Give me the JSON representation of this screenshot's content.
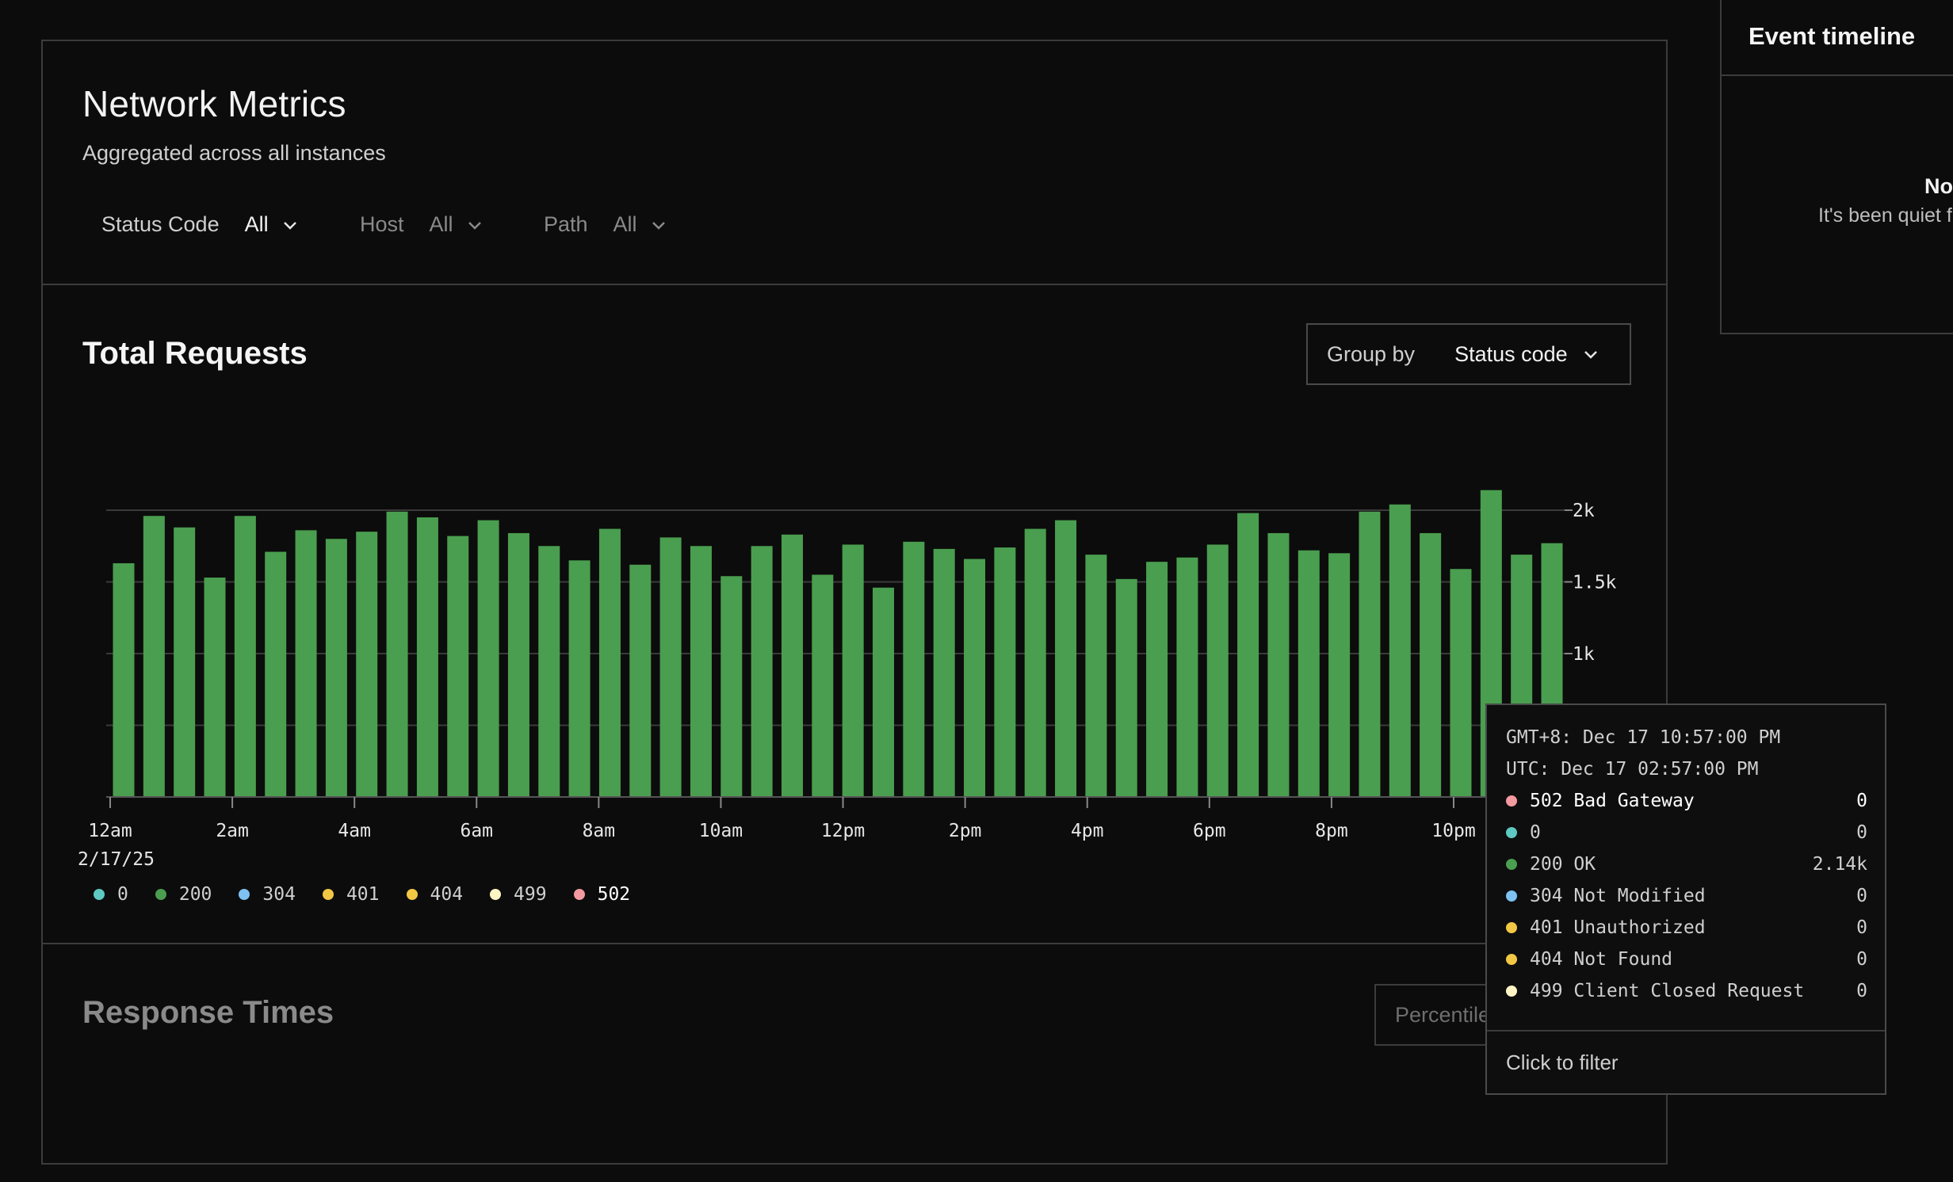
{
  "header": {
    "title": "Network Metrics",
    "subtitle": "Aggregated across all instances",
    "filters": [
      {
        "label": "Status Code",
        "value": "All"
      },
      {
        "label": "Host",
        "value": "All"
      },
      {
        "label": "Path",
        "value": "All"
      }
    ]
  },
  "requests": {
    "title": "Total Requests",
    "group_by_label": "Group by",
    "group_by_value": "Status code"
  },
  "chart_data": {
    "type": "bar",
    "title": "Total Requests",
    "x_tick_labels": [
      "12am",
      "2am",
      "4am",
      "6am",
      "8am",
      "10am",
      "12pm",
      "2pm",
      "4pm",
      "6pm",
      "8pm",
      "10pm"
    ],
    "date_label": "2/17/25",
    "y_tick_labels": [
      "2k",
      "1.5k",
      "1k"
    ],
    "ylim": [
      0,
      2000
    ],
    "grid": true,
    "series": [
      {
        "name": "200",
        "color": "#4a9e4f",
        "values": [
          1630,
          1960,
          1880,
          1530,
          1960,
          1710,
          1860,
          1800,
          1850,
          1990,
          1950,
          1820,
          1930,
          1840,
          1750,
          1650,
          1870,
          1620,
          1810,
          1750,
          1540,
          1750,
          1830,
          1550,
          1760,
          1460,
          1780,
          1730,
          1660,
          1740,
          1870,
          1930,
          1690,
          1520,
          1640,
          1670,
          1760,
          1980,
          1840,
          1720,
          1700,
          1990,
          2040,
          1840,
          1590,
          2140,
          1690,
          1770
        ]
      }
    ],
    "legend": [
      {
        "label": "0",
        "color": "#5ec9c2"
      },
      {
        "label": "200",
        "color": "#4a9e4f"
      },
      {
        "label": "304",
        "color": "#7ec1f2"
      },
      {
        "label": "401",
        "color": "#f2c744"
      },
      {
        "label": "404",
        "color": "#f2c744"
      },
      {
        "label": "499",
        "color": "#fff5c4"
      },
      {
        "label": "502",
        "color": "#f29aa0"
      }
    ]
  },
  "tooltip": {
    "local_time": "GMT+8: Dec 17 10:57:00 PM",
    "utc_time": "UTC: Dec 17 02:57:00 PM",
    "rows": [
      {
        "name": "502 Bad Gateway",
        "value": "0",
        "color": "#f29aa0"
      },
      {
        "name": "0",
        "value": "0",
        "color": "#5ec9c2"
      },
      {
        "name": "200 OK",
        "value": "2.14k",
        "color": "#4a9e4f"
      },
      {
        "name": "304 Not Modified",
        "value": "0",
        "color": "#7ec1f2"
      },
      {
        "name": "401 Unauthorized",
        "value": "0",
        "color": "#f2c744"
      },
      {
        "name": "404 Not Found",
        "value": "0",
        "color": "#f2c744"
      },
      {
        "name": "499 Client Closed Request",
        "value": "0",
        "color": "#fff5c4"
      }
    ],
    "footer": "Click to filter"
  },
  "response": {
    "title": "Response Times",
    "percentile_label": "Percentile"
  },
  "events": {
    "title": "Event timeline",
    "empty_title": "No",
    "empty_subtitle": "It's been quiet f"
  }
}
